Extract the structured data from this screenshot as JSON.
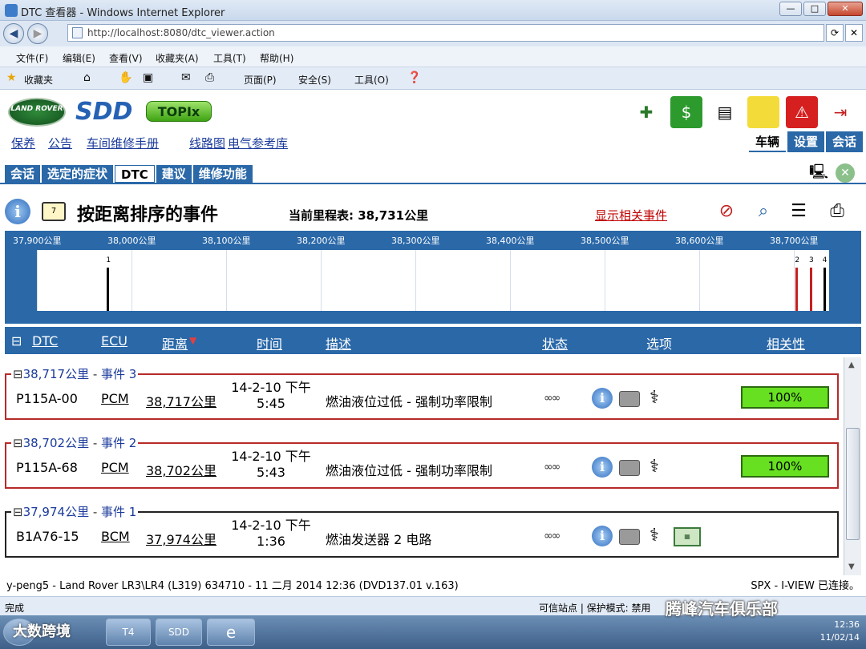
{
  "window": {
    "title": "DTC 查看器 - Windows Internet Explorer",
    "url": "http://localhost:8080/dtc_viewer.action",
    "menu": [
      "文件(F)",
      "编辑(E)",
      "查看(V)",
      "收藏夹(A)",
      "工具(T)",
      "帮助(H)"
    ],
    "favorites_label": "收藏夹",
    "toolbar": {
      "page": "页面(P)",
      "safety": "安全(S)",
      "tools": "工具(O)"
    }
  },
  "app": {
    "logo_lr": "LAND ROVER",
    "logo_sdd": "SDD",
    "logo_topix": "TOPIx",
    "top_links": [
      "保养",
      "公告",
      "车间维修手册",
      "线路图",
      "电气参考库"
    ],
    "right_tabs": [
      "车辆",
      "设置",
      "会话"
    ],
    "sub_tabs": [
      "会话",
      "选定的症状",
      "DTC",
      "建议",
      "维修功能"
    ],
    "active_sub_tab": "DTC",
    "events_title": "按距离排序的事件",
    "odometer_label": "当前里程表: 38,731公里",
    "show_related": "显示相关事件"
  },
  "timeline": {
    "tick_labels": [
      "37,900公里",
      "38,000公里",
      "38,100公里",
      "38,200公里",
      "38,300公里",
      "38,400公里",
      "38,500公里",
      "38,600公里",
      "38,700公里"
    ],
    "range_km": [
      37900,
      38731
    ],
    "markers": [
      {
        "num": "1",
        "km": 37974,
        "color": "black"
      },
      {
        "num": "2",
        "km": 38702,
        "color": "red"
      },
      {
        "num": "3",
        "km": 38717,
        "color": "red"
      },
      {
        "num": "4",
        "km": 38731,
        "color": "black"
      }
    ]
  },
  "table": {
    "headers": {
      "dtc": "DTC",
      "ecu": "ECU",
      "distance": "距离",
      "time": "时间",
      "desc": "描述",
      "status": "状态",
      "options": "选项",
      "relevance": "相关性"
    },
    "events": [
      {
        "legend_km": "38,717公里",
        "legend_event": "事件 3",
        "dtc": "P115A-00",
        "ecu": "PCM",
        "distance": "38,717公里",
        "time1": "14-2-10 下午",
        "time2": "5:45",
        "desc": "燃油液位过低 - 强制功率限制",
        "relevance": "100%"
      },
      {
        "legend_km": "38,702公里",
        "legend_event": "事件 2",
        "dtc": "P115A-68",
        "ecu": "PCM",
        "distance": "38,702公里",
        "time1": "14-2-10 下午",
        "time2": "5:43",
        "desc": "燃油液位过低 - 强制功率限制",
        "relevance": "100%"
      },
      {
        "legend_km": "37,974公里",
        "legend_event": "事件 1",
        "dtc": "B1A76-15",
        "ecu": "BCM",
        "distance": "37,974公里",
        "time1": "14-2-10 下午",
        "time2": "1:36",
        "desc": "燃油发送器 2 电路",
        "relevance": ""
      }
    ]
  },
  "statusline": {
    "left": "y-peng5 - Land Rover LR3\\LR4 (L319) 634710 - 11 二月 2014 12:36 (DVD137.01 v.163)",
    "right": "SPX - I-VIEW 已连接。"
  },
  "iestatus": {
    "left": "完成",
    "trusted": "可信站点 | 保护模式: 禁用"
  },
  "taskbar": {
    "sdd": "SDD",
    "clock": "12:36",
    "date": "11/02/14"
  },
  "watermark": {
    "right": "腾峰汽车俱乐部",
    "left": "大数跨境"
  }
}
